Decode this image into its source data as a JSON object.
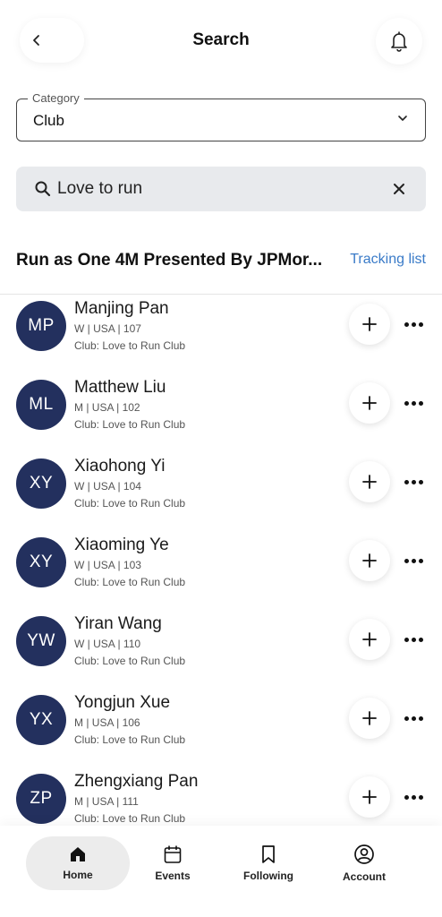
{
  "header": {
    "title": "Search",
    "back_icon": "chevron-left-icon",
    "bell_icon": "bell-icon"
  },
  "category": {
    "label": "Category",
    "value": "Club"
  },
  "search": {
    "value": "Love to run",
    "placeholder": "Search"
  },
  "event": {
    "name": "Run as One 4M Presented By JPMor...",
    "tracking_label": "Tracking list",
    "link_color": "#3a7bc8"
  },
  "runners": [
    {
      "initials": "MP",
      "name": "Manjing Pan",
      "meta": "W | USA | 107",
      "club": "Club: Love to Run Club"
    },
    {
      "initials": "ML",
      "name": "Matthew Liu",
      "meta": "M | USA | 102",
      "club": "Club: Love to Run Club"
    },
    {
      "initials": "XY",
      "name": "Xiaohong Yi",
      "meta": "W | USA | 104",
      "club": "Club: Love to Run Club"
    },
    {
      "initials": "XY",
      "name": "Xiaoming Ye",
      "meta": "W | USA | 103",
      "club": "Club: Love to Run Club"
    },
    {
      "initials": "YW",
      "name": "Yiran Wang",
      "meta": "W | USA | 110",
      "club": "Club: Love to Run Club"
    },
    {
      "initials": "YX",
      "name": "Yongjun Xue",
      "meta": "M | USA | 106",
      "club": "Club: Love to Run Club"
    },
    {
      "initials": "ZP",
      "name": "Zhengxiang Pan",
      "meta": "M | USA | 111",
      "club": "Club: Love to Run Club"
    }
  ],
  "avatar_color": "#23305e",
  "tabs": [
    {
      "label": "Home",
      "icon": "home-icon",
      "active": true
    },
    {
      "label": "Events",
      "icon": "calendar-icon",
      "active": false
    },
    {
      "label": "Following",
      "icon": "bookmark-icon",
      "active": false
    },
    {
      "label": "Account",
      "icon": "account-icon",
      "active": false
    }
  ]
}
